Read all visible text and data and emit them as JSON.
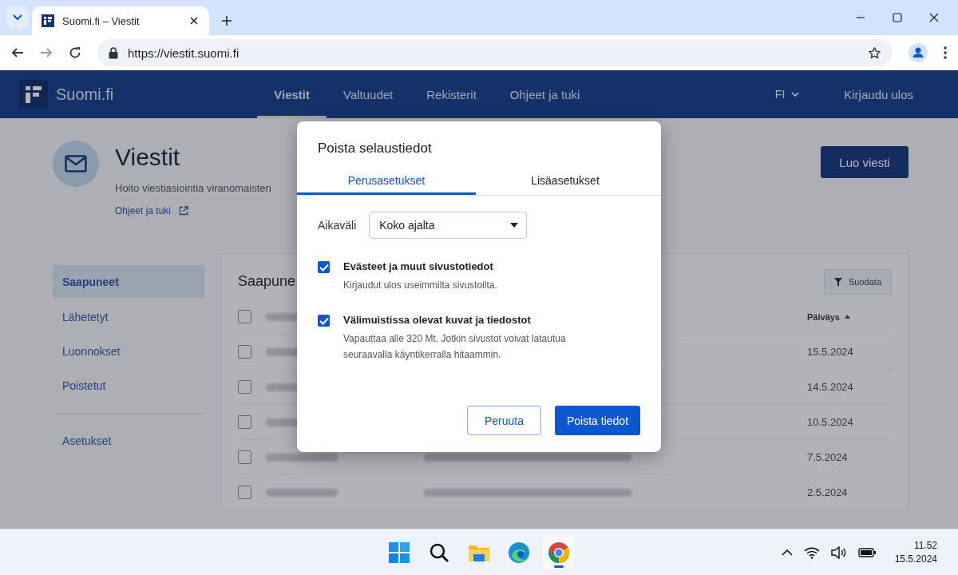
{
  "browser": {
    "tab_title": "Suomi.fi – Viestit",
    "url": "https://viestit.suomi.fi"
  },
  "site": {
    "logo": "Suomi.fi",
    "nav": [
      {
        "label": "Viestit",
        "selected": true
      },
      {
        "label": "Valtuudet",
        "selected": false
      },
      {
        "label": "Rekisterit",
        "selected": false
      },
      {
        "label": "Ohjeet ja tuki",
        "selected": false
      }
    ],
    "language": "FI",
    "logout": "Kirjaudu ulos"
  },
  "page": {
    "title": "Viestit",
    "description": "Hoito viestiasiointia viranomaisten",
    "help_link": "Ohjeet ja tuki",
    "create_button": "Luo viesti"
  },
  "sidebar": {
    "items": [
      {
        "label": "Saapuneet",
        "selected": true
      },
      {
        "label": "Lähetetyt",
        "selected": false
      },
      {
        "label": "Luonnokset",
        "selected": false
      },
      {
        "label": "Poistetut",
        "selected": false
      }
    ],
    "settings": "Asetukset"
  },
  "table": {
    "title": "Saapune",
    "filter_button": "Suodata",
    "date_column": "Päiväys",
    "header_checked": false,
    "rows": [
      {
        "date": "15.5.2024",
        "checked": false
      },
      {
        "date": "14.5.2024",
        "checked": false
      },
      {
        "date": "10.5.2024",
        "checked": false
      },
      {
        "date": "7.5.2024",
        "checked": false
      },
      {
        "date": "2.5.2024",
        "checked": false
      }
    ]
  },
  "dialog": {
    "title": "Poista selaustiedot",
    "tabs": [
      {
        "label": "Perusasetukset",
        "selected": true
      },
      {
        "label": "Lisäasetukset",
        "selected": false
      }
    ],
    "range_label": "Aikaväli",
    "range_value": "Koko ajalta",
    "options": [
      {
        "label": "Evästeet ja muut sivustotiedot",
        "description": "Kirjaudut ulos useimmilta sivustoilta.",
        "checked": true
      },
      {
        "label": "Välimuistissa olevat kuvat ja tiedostot",
        "description": "Vapauttaa alle 320 Mt. Jotkin sivustot voivat latautua seuraavalla käyntikerralla hitaammin.",
        "checked": true
      }
    ],
    "cancel": "Peruuta",
    "confirm": "Poista tiedot"
  },
  "taskbar": {
    "apps": [
      {
        "kind": "start",
        "selected": false
      },
      {
        "kind": "search",
        "selected": false
      },
      {
        "kind": "files",
        "selected": false
      },
      {
        "kind": "edge",
        "selected": false
      },
      {
        "kind": "chrome",
        "selected": true
      }
    ],
    "time": "11.52",
    "date": "15.5.2024"
  }
}
